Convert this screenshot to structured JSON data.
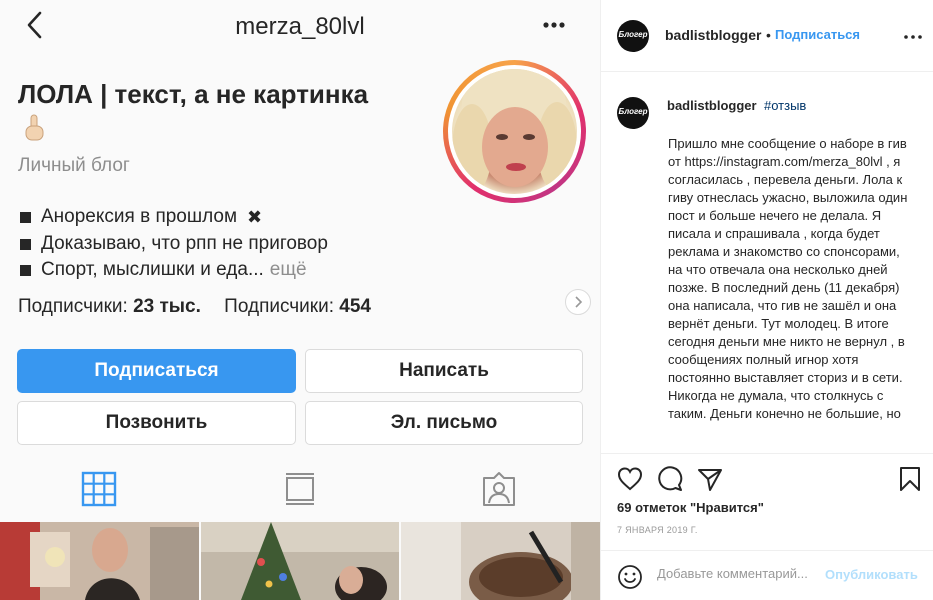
{
  "profile": {
    "username": "merza_80lvl",
    "name": "ЛОЛА | текст, а не картинка",
    "category": "Личный блог",
    "bio": [
      {
        "text": "Анорексия в прошлом",
        "suffix": "✖"
      },
      {
        "text": "Доказываю, что рпп не приговор"
      },
      {
        "text": "Спорт, мыслишки и еда...",
        "more": "ещё"
      }
    ],
    "stats": {
      "followers_label": "Подписчики:",
      "followers_value": "23 тыс.",
      "following_label": "Подписчики:",
      "following_value": "454"
    },
    "buttons": {
      "subscribe": "Подписаться",
      "message": "Написать",
      "call": "Позвонить",
      "email": "Эл. письмо"
    },
    "tabs": [
      "grid-icon",
      "igtv-icon",
      "tagged-icon"
    ],
    "accent_color": "#3897f0"
  },
  "post": {
    "author": "badlistblogger",
    "author_avatar_text": "Блогер",
    "separator": "•",
    "follow_label": "Подписаться",
    "caption_user": "badlistblogger",
    "caption_tag": "#отзыв",
    "caption_text": "Пришло мне сообщение о наборе в гив от https://instagram.com/merza_80lvl , я согласилась , перевела деньги. Лола к гиву отнеслась ужасно, выложила один пост и больше нечего не делала. Я писала и спрашивала , когда будет реклама и знакомство со спонсорами, на что отвечала она несколько дней позже. В последний день (11 декабря) она написала, что гив не зашёл и она вернёт деньги. Тут молодец. В итоге сегодня деньги мне никто не вернул , в сообщениях полный игнор хотя постоянно выставляет сториз и в сети. Никогда не думала, что столкнусь с таким. Деньги конечно не большие, но",
    "likes": "69 отметок \"Нравится\"",
    "date": "7 ЯНВАРЯ 2019 Г.",
    "comment_placeholder": "Добавьте комментарий...",
    "publish_label": "Опубликовать"
  }
}
